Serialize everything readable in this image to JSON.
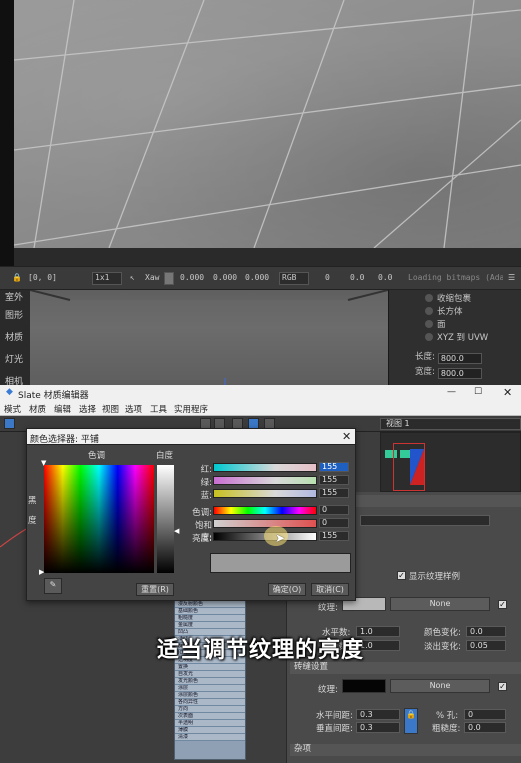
{
  "status_bar": {
    "coords": "[0, 0]",
    "zoom": "1x1",
    "mode": "Xaw",
    "x": "0.000",
    "y": "0.000",
    "z": "0.000",
    "color_mode": "RGB",
    "v1": "0",
    "v2": "0.0",
    "v3": "0.0",
    "loading": "Loading bitmaps (Adapt)"
  },
  "left_labels": [
    "室外",
    "图形",
    "材质",
    "灯光",
    "相机"
  ],
  "right_panel": {
    "radio1": "收缩包裹",
    "radio2": "长方体",
    "radio3": "面",
    "radio4": "XYZ 到 UVW",
    "length_label": "长度:",
    "length_value": "800.0",
    "width_label": "宽度:",
    "width_value": "800.0"
  },
  "slate": {
    "title": "Slate 材质编辑器",
    "menus": [
      "模式",
      "材质",
      "编辑",
      "选择",
      "视图",
      "选项",
      "工具",
      "实用程序"
    ],
    "view_label": "视图 1"
  },
  "color_dialog": {
    "title": "颜色选择器: 平铺",
    "hue_label": "色调",
    "whiteness_label": "白度",
    "black_label": "黑",
    "degree_label": "度",
    "sliders": [
      {
        "label": "红:",
        "value": "155"
      },
      {
        "label": "绿:",
        "value": "155"
      },
      {
        "label": "蓝:",
        "value": "155"
      },
      {
        "label": "色调:",
        "value": "0"
      },
      {
        "label": "饱和度:",
        "value": "0"
      },
      {
        "label": "亮度:",
        "value": "155"
      }
    ],
    "reset_label": "重置(R)",
    "ok_label": "确定(O)",
    "cancel_label": "取消(C)",
    "swatch_color": "#9b9b9b"
  },
  "params": {
    "show_texture": "显示纹理样例",
    "texture_label": "纹理:",
    "none_1": "None",
    "h_count_label": "水平数:",
    "h_count_value": "1.0",
    "v_count_label": "垂直数:",
    "v_count_value": "1.0",
    "color_var_label": "颜色变化:",
    "color_var_value": "0.0",
    "fade_var_label": "淡出变化:",
    "fade_var_value": "0.05",
    "grout_section": "砖缝设置",
    "grout_texture_label": "纹理:",
    "none_2": "None",
    "h_gap_label": "水平间距:",
    "h_gap_value": "0.3",
    "v_gap_label": "垂直间距:",
    "v_gap_value": "0.3",
    "holes_label": "% 孔:",
    "holes_value": "0",
    "rough_label": "粗糙度:",
    "rough_value": "0.0",
    "misc_section": "杂项"
  },
  "node_list": [
    "漫反射颜色",
    "基础颜色",
    "粗糙度",
    "金属度",
    "凹凸",
    "法线",
    "反射颜色",
    "IOR",
    "透明度",
    "置换",
    "自发光",
    "发光颜色",
    "涂层",
    "涂层颜色",
    "各向异性",
    "方向",
    "次表面",
    "半透明",
    "薄膜",
    "清漆"
  ],
  "subtitle": "适当调节纹理的亮度"
}
